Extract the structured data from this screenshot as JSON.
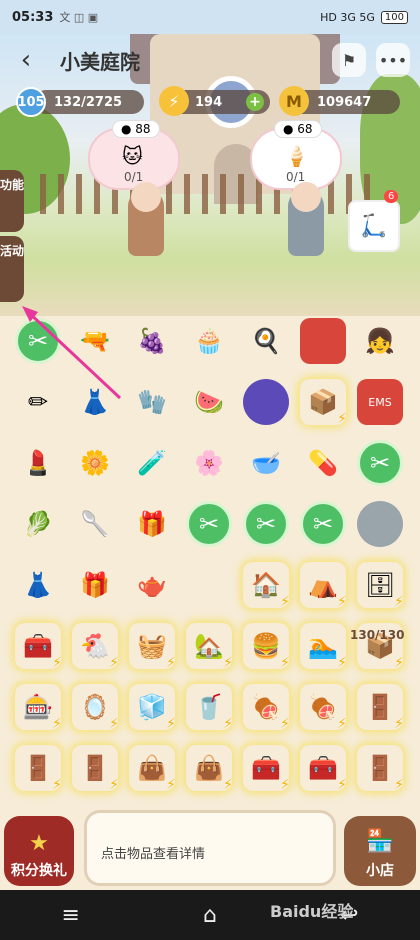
{
  "status": {
    "time": "05:33",
    "icons": "文 ◫ ▣",
    "signal": "HD 3G 5G",
    "battery": "100"
  },
  "header": {
    "title": "小美庭院"
  },
  "resources": {
    "level": "105",
    "exp": "132/2725",
    "energy": "194",
    "coins": "109647"
  },
  "orders": [
    {
      "coins": "88",
      "progress": "0/1"
    },
    {
      "coins": "68",
      "progress": "0/1"
    }
  ],
  "side_tabs": {
    "func": "功能",
    "activity": "活动"
  },
  "vehicle_badge": "6",
  "stock_label": "130/130",
  "bottom": {
    "points_label": "积分换礼",
    "info_text": "点击物品查看详情",
    "shop_label": "小店"
  },
  "watermark": "Baidu经验",
  "colors": {
    "accent": "#f44",
    "brown": "#6d4a36",
    "green": "#4fbf66"
  }
}
